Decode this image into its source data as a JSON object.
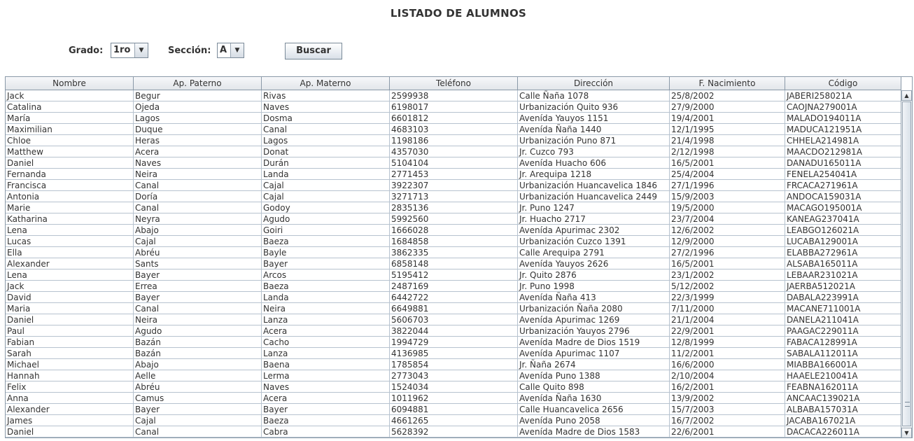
{
  "title": "LISTADO DE ALUMNOS",
  "filters": {
    "grado_label": "Grado:",
    "grado_value": "1ro",
    "seccion_label": "Sección:",
    "seccion_value": "A",
    "search_label": "Buscar"
  },
  "table": {
    "columns": [
      "Nombre",
      "Ap. Paterno",
      "Ap. Materno",
      "Teléfono",
      "Dirección",
      "F. Nacimiento",
      "Código"
    ],
    "rows": [
      [
        "Jack",
        "Begur",
        "Rivas",
        "2599938",
        "Calle Ñaña 1078",
        "25/8/2002",
        "JABERI258021A"
      ],
      [
        "Catalina",
        "Ojeda",
        "Naves",
        "6198017",
        "Urbanización Quito 936",
        "27/9/2000",
        "CAOJNA279001A"
      ],
      [
        "María",
        "Lagos",
        "Dosma",
        "6601812",
        "Avenída Yauyos 1151",
        "19/4/2001",
        "MALADO194011A"
      ],
      [
        "Maximilian",
        "Duque",
        "Canal",
        "4683103",
        "Avenída Ñaña 1440",
        "12/1/1995",
        "MADUCA121951A"
      ],
      [
        "Chloe",
        "Heras",
        "Lagos",
        "1198186",
        "Urbanización Puno 871",
        "21/4/1998",
        "CHHELA214981A"
      ],
      [
        "Matthew",
        "Acera",
        "Donat",
        "4357030",
        "Jr. Cuzco 793",
        "2/12/1998",
        "MAACDO212981A"
      ],
      [
        "Daniel",
        "Naves",
        "Durán",
        "5104104",
        "Avenída Huacho 606",
        "16/5/2001",
        "DANADU165011A"
      ],
      [
        "Fernanda",
        "Neira",
        "Landa",
        "2771453",
        "Jr. Arequipa 1218",
        "25/4/2004",
        "FENELA254041A"
      ],
      [
        "Francisca",
        "Canal",
        "Cajal",
        "3922307",
        "Urbanización Huancavelica 1846",
        "27/1/1996",
        "FRCACA271961A"
      ],
      [
        "Antonia",
        "Doría",
        "Cajal",
        "3271713",
        "Urbanización Huancavelica 2449",
        "15/9/2003",
        "ANDOCA159031A"
      ],
      [
        "Marie",
        "Canal",
        "Godoy",
        "2835136",
        "Jr. Puno 1247",
        "19/5/2000",
        "MACAGO195001A"
      ],
      [
        "Katharina",
        "Neyra",
        "Agudo",
        "5992560",
        "Jr. Huacho 2717",
        "23/7/2004",
        "KANEAG237041A"
      ],
      [
        "Lena",
        "Abajo",
        "Goiri",
        "1666028",
        "Avenída Apurimac 2302",
        "12/6/2002",
        "LEABGO126021A"
      ],
      [
        "Lucas",
        "Cajal",
        "Baeza",
        "1684858",
        "Urbanización Cuzco 1391",
        "12/9/2000",
        "LUCABA129001A"
      ],
      [
        "Ella",
        "Abréu",
        "Bayle",
        "3862335",
        "Calle Arequipa 2791",
        "27/2/1996",
        "ELABBA272961A"
      ],
      [
        "Alexander",
        "Sants",
        "Bayer",
        "6858148",
        "Avenída Yauyos 2626",
        "16/5/2001",
        "ALSABA165011A"
      ],
      [
        "Lena",
        "Bayer",
        "Arcos",
        "5195412",
        "Jr. Quito 2876",
        "23/1/2002",
        "LEBAAR231021A"
      ],
      [
        "Jack",
        "Errea",
        "Baeza",
        "2487169",
        "Jr. Puno 1998",
        "5/12/2002",
        "JAERBA512021A"
      ],
      [
        "David",
        "Bayer",
        "Landa",
        "6442722",
        "Avenída Ñaña 413",
        "22/3/1999",
        "DABALA223991A"
      ],
      [
        "Maria",
        "Canal",
        "Neira",
        "6649881",
        "Urbanización Ñaña 2080",
        "7/11/2000",
        "MACANE711001A"
      ],
      [
        "Daniel",
        "Neira",
        "Lanza",
        "5606703",
        "Avenída Apurimac 1269",
        "21/1/2004",
        "DANELA211041A"
      ],
      [
        "Paul",
        "Agudo",
        "Acera",
        "3822044",
        "Urbanización Yauyos 2796",
        "22/9/2001",
        "PAAGAC229011A"
      ],
      [
        "Fabian",
        "Bazán",
        "Cacho",
        "1994729",
        "Avenída Madre de Dios 1519",
        "12/8/1999",
        "FABACA128991A"
      ],
      [
        "Sarah",
        "Bazán",
        "Lanza",
        "4136985",
        "Avenída Apurimac 1107",
        "11/2/2001",
        "SABALA112011A"
      ],
      [
        "Michael",
        "Abajo",
        "Baena",
        "1785854",
        "Jr. Ñaña 2674",
        "16/6/2000",
        "MIABBA166001A"
      ],
      [
        "Hannah",
        "Aelle",
        "Lerma",
        "2773043",
        "Avenída Puno 1388",
        "2/10/2004",
        "HAAELE210041A"
      ],
      [
        "Felix",
        "Abréu",
        "Naves",
        "1524034",
        "Calle Quito 898",
        "16/2/2001",
        "FEABNA162011A"
      ],
      [
        "Anna",
        "Camus",
        "Acera",
        "1011962",
        "Avenída Ñaña 1630",
        "13/9/2002",
        "ANCAAC139021A"
      ],
      [
        "Alexander",
        "Bayer",
        "Bayer",
        "6094881",
        "Calle Huancavelica 2656",
        "15/7/2003",
        "ALBABA157031A"
      ],
      [
        "James",
        "Cajal",
        "Baeza",
        "4661265",
        "Avenída Puno 2058",
        "16/7/2002",
        "JACABA167021A"
      ],
      [
        "Daniel",
        "Canal",
        "Cabra",
        "5628392",
        "Avenída Madre de Dios 1583",
        "22/6/2001",
        "DACACA226011A"
      ]
    ]
  },
  "icons": {
    "combo_arrow": "▼",
    "scroll_up": "▲",
    "scroll_down": "▼"
  }
}
